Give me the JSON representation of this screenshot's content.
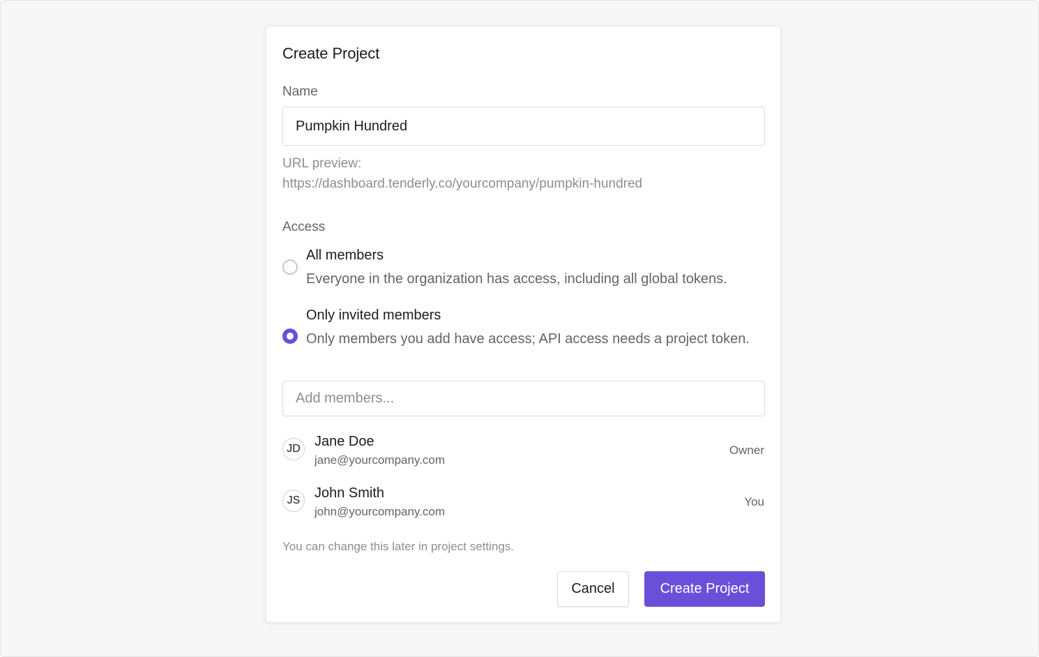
{
  "dialog": {
    "title": "Create Project"
  },
  "name_field": {
    "label": "Name",
    "value": "Pumpkin Hundred"
  },
  "url_preview": {
    "label": "URL preview:",
    "value": "https://dashboard.tenderly.co/yourcompany/pumpkin-hundred"
  },
  "access": {
    "label": "Access",
    "selected": "only_invited",
    "options": [
      {
        "title": "All members",
        "description": "Everyone in the organization has access, including all global tokens."
      },
      {
        "title": "Only invited members",
        "description": "Only members you add have access; API access needs a project token."
      }
    ]
  },
  "members_search": {
    "placeholder": "Add members..."
  },
  "members": [
    {
      "initials": "JD",
      "name": "Jane Doe",
      "email": "jane@yourcompany.com",
      "role": "Owner"
    },
    {
      "initials": "JS",
      "name": "John Smith",
      "email": "john@yourcompany.com",
      "role": "You"
    }
  ],
  "hint": "You can change this later in project settings.",
  "actions": {
    "cancel_label": "Cancel",
    "create_label": "Create Project"
  },
  "colors": {
    "accent": "#6b4fd8",
    "background": "#f7f7f7"
  }
}
